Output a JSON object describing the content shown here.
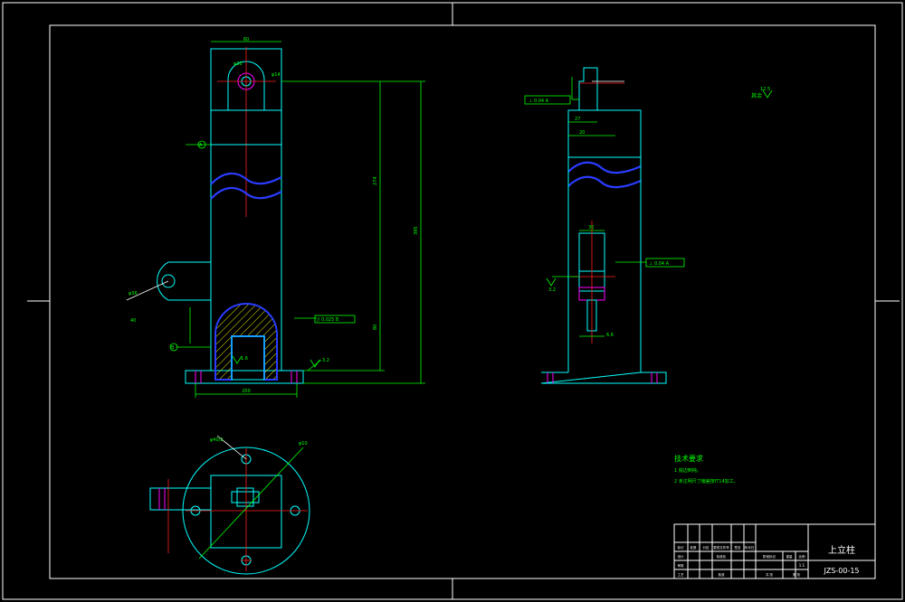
{
  "drawing": {
    "dims": {
      "top_width": "60",
      "dia_small": "φ30",
      "dia_big": "φ65",
      "hole_dia": "φ14",
      "height_upper": "274",
      "height_total": "395",
      "height_lower": "80",
      "base_width": "200",
      "arm_dim": "φ36",
      "arm_len": "40",
      "side_27": "27",
      "side_20": "20",
      "side_30": "30",
      "side_66": "6.6",
      "bottom_dia_a": "φ40/2",
      "bottom_dia_b": "φ10",
      "datum_a": "A",
      "datum_b": "B"
    },
    "tolerances": {
      "parallel_box": "// 0.025 B",
      "perp_box_top": "⊥ 0.04 A",
      "perp_box_side": "⊥ 0.04 A"
    },
    "roughness": {
      "general": "其余",
      "r1": "3.2",
      "r2": "1.6",
      "r3": "3.2",
      "r4": "12.5"
    },
    "tech_req": {
      "title": "技术要求",
      "items": [
        "1 锐边倒钝。",
        "2 未注明尺寸偏差按IT14加工。"
      ]
    },
    "title_block": {
      "part_name": "上立柱",
      "drawing_no": "JZS-00-15",
      "scale": "1:1",
      "headers": [
        "标记",
        "处数",
        "分区",
        "更改文件号",
        "签名",
        "年月日"
      ],
      "row2": [
        "设计",
        "",
        "标准化",
        "",
        "阶段标记",
        "重量",
        "比例"
      ],
      "row3": [
        "审核",
        "",
        "",
        "",
        "",
        "",
        ""
      ],
      "row4": [
        "工艺",
        "",
        "批准",
        "",
        "共 张",
        "第 张"
      ]
    }
  },
  "colors": {
    "background": "#000000",
    "outline": "#00ffff",
    "dimension": "#00ff00",
    "centerline": "#ff2020",
    "section": "#2a3cff",
    "frame": "#ffffff"
  }
}
